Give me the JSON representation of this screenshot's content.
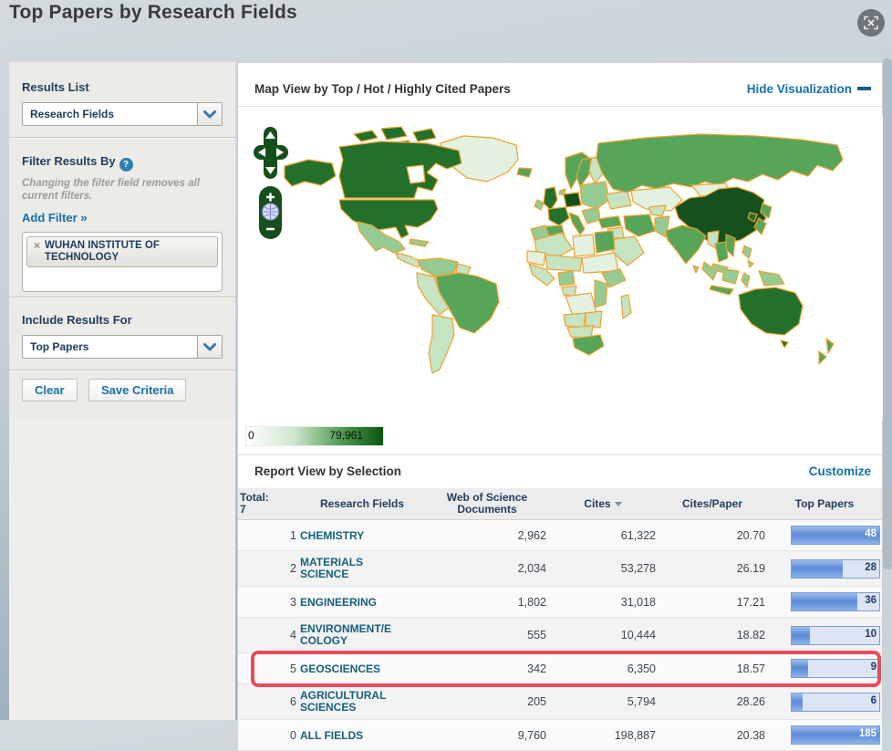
{
  "page": {
    "title": "Top Papers by Research Fields"
  },
  "sidebar": {
    "results_list": {
      "label": "Results List",
      "selected": "Research Fields"
    },
    "filter": {
      "heading": "Filter Results By",
      "note": "Changing the filter field removes all current filters.",
      "add_filter_label": "Add Filter »",
      "tag": {
        "remove_glyph": "×",
        "label": "WUHAN INSTITUTE OF TECHNOLOGY"
      }
    },
    "include_results": {
      "label": "Include Results For",
      "selected": "Top Papers"
    },
    "buttons": {
      "clear": "Clear",
      "save": "Save Criteria"
    }
  },
  "map_section": {
    "title": "Map View by Top / Hot / Highly Cited Papers",
    "hide_link": "Hide Visualization",
    "legend": {
      "min": "0",
      "max": "79,961"
    },
    "palette": {
      "l0": "#e3f1e0",
      "l1": "#c6e3c2",
      "l2": "#95cb92",
      "l3": "#57a559",
      "l4": "#23702a",
      "l5": "#16501c",
      "nodata": "#ffffff",
      "border": "#efa22f",
      "water": "#ffffff",
      "control": "#174f1b"
    }
  },
  "report": {
    "title": "Report View by Selection",
    "customize_link": "Customize",
    "total_label": "Total:",
    "total_count": "7",
    "columns": {
      "field": "Research Fields",
      "docs": "Web of Science Documents",
      "cites": "Cites",
      "cpp": "Cites/Paper",
      "top": "Top Papers"
    },
    "sorted_column": "Cites",
    "rows": [
      {
        "rank": "1",
        "field": "CHEMISTRY",
        "docs": "2,962",
        "cites": "61,322",
        "cpp": "20.70",
        "top": "48",
        "bar_pct": 100,
        "highlighted": false
      },
      {
        "rank": "2",
        "field": "MATERIALS SCIENCE",
        "docs": "2,034",
        "cites": "53,278",
        "cpp": "26.19",
        "top": "28",
        "bar_pct": 58,
        "highlighted": false
      },
      {
        "rank": "3",
        "field": "ENGINEERING",
        "docs": "1,802",
        "cites": "31,018",
        "cpp": "17.21",
        "top": "36",
        "bar_pct": 75,
        "highlighted": false
      },
      {
        "rank": "4",
        "field": "ENVIRONMENT/ECOLOGY",
        "docs": "555",
        "cites": "10,444",
        "cpp": "18.82",
        "top": "10",
        "bar_pct": 21,
        "highlighted": false
      },
      {
        "rank": "5",
        "field": "GEOSCIENCES",
        "docs": "342",
        "cites": "6,350",
        "cpp": "18.57",
        "top": "9",
        "bar_pct": 19,
        "highlighted": true
      },
      {
        "rank": "6",
        "field": "AGRICULTURAL SCIENCES",
        "docs": "205",
        "cites": "5,794",
        "cpp": "28.26",
        "top": "6",
        "bar_pct": 13,
        "highlighted": false
      },
      {
        "rank": "0",
        "field": "ALL FIELDS",
        "docs": "9,760",
        "cites": "198,887",
        "cpp": "20.38",
        "top": "185",
        "bar_pct": 100,
        "highlighted": false
      }
    ]
  }
}
